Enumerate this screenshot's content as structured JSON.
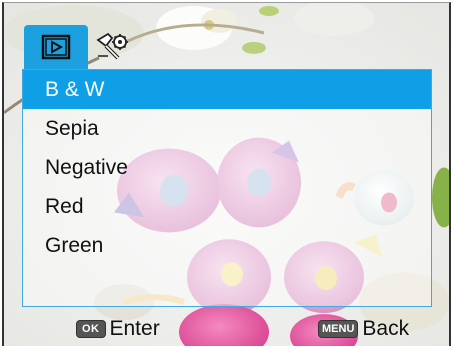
{
  "tabs": [
    {
      "icon": "playback-icon",
      "active": true
    },
    {
      "icon": "setup-icon",
      "active": false
    }
  ],
  "menu": {
    "items": [
      {
        "label": "B & W",
        "selected": true
      },
      {
        "label": "Sepia",
        "selected": false
      },
      {
        "label": "Negative",
        "selected": false
      },
      {
        "label": "Red",
        "selected": false
      },
      {
        "label": "Green",
        "selected": false
      }
    ]
  },
  "footer": {
    "enter": {
      "key": "OK",
      "label": "Enter"
    },
    "back": {
      "key": "MENU",
      "label": "Back"
    }
  },
  "colors": {
    "accent": "#0f9fe6",
    "panel_border": "#42a8e0"
  }
}
